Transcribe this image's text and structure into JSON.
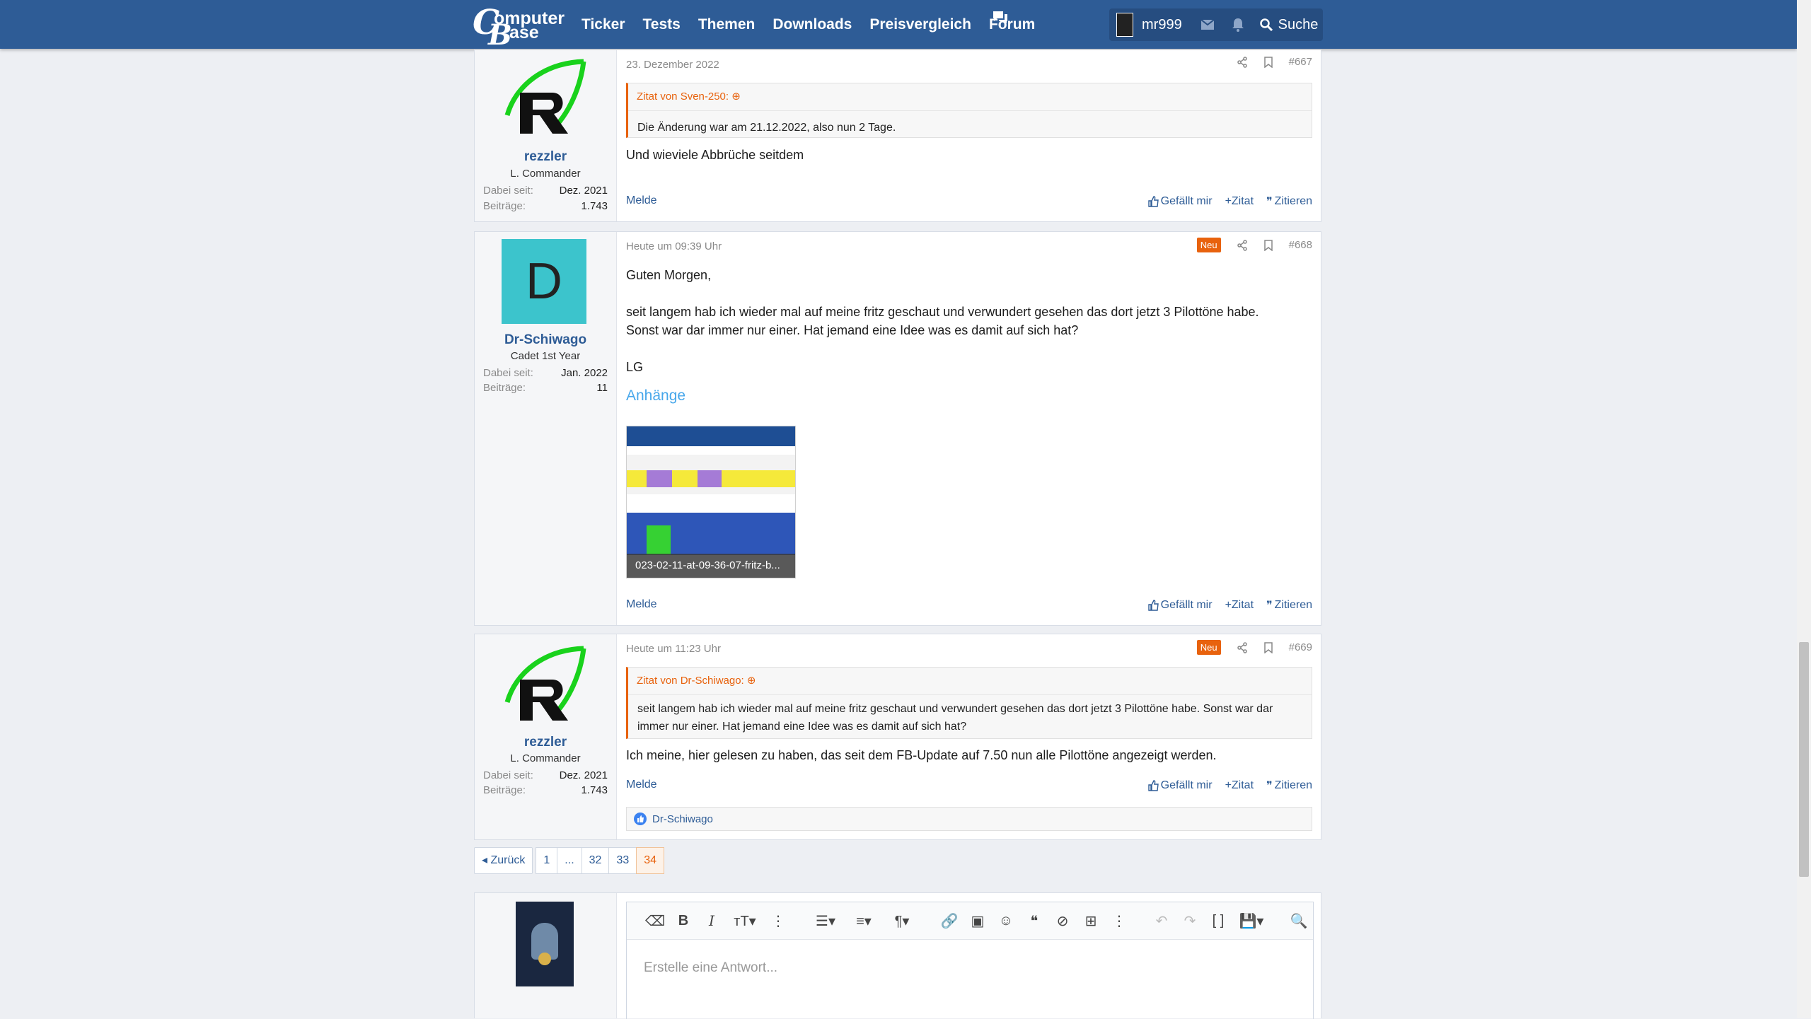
{
  "header": {
    "logo_line1": "omputer",
    "logo_line2": "ase",
    "logo_c": "C",
    "logo_b": "B",
    "nav": [
      "Ticker",
      "Tests",
      "Themen",
      "Downloads",
      "Preisvergleich",
      "Forum"
    ],
    "username": "mr999",
    "search_label": "Suche"
  },
  "posts": [
    {
      "author": "rezzler",
      "user_title": "L. Commander",
      "stats": [
        {
          "k": "Dabei seit:",
          "v": "Dez. 2021"
        },
        {
          "k": "Beiträge:",
          "v": "1.743"
        }
      ],
      "date": "23. Dezember 2022",
      "number": "#667",
      "quote_header": "Zitat von Sven-250:",
      "quote_text": "Die Änderung war am 21.12.2022, also nun 2 Tage.",
      "body": [
        "Und wieviele Abbrüche seitdem"
      ],
      "report": "Melde",
      "actions": [
        "Gefällt mir",
        "+Zitat",
        "Zitieren"
      ]
    },
    {
      "author": "Dr-Schiwago",
      "avatar_letter": "D",
      "avatar_color": "#3cc4cc",
      "user_title": "Cadet 1st Year",
      "stats": [
        {
          "k": "Dabei seit:",
          "v": "Jan. 2022"
        },
        {
          "k": "Beiträge:",
          "v": "11"
        }
      ],
      "date": "Heute um 09:39 Uhr",
      "badge": "Neu",
      "number": "#668",
      "body": [
        "Guten Morgen,",
        "seit langem hab ich wieder mal auf meine fritz geschaut und verwundert gesehen das dort jetzt 3 Pilottöne habe.",
        "Sonst war dar immer nur einer. Hat jemand eine Idee was es damit auf sich hat?",
        "LG"
      ],
      "attachments_title": "Anhänge",
      "attachment_caption": "023-02-11-at-09-36-07-fritz-b...",
      "report": "Melde",
      "actions": [
        "Gefällt mir",
        "+Zitat",
        "Zitieren"
      ]
    },
    {
      "author": "rezzler",
      "user_title": "L. Commander",
      "stats": [
        {
          "k": "Dabei seit:",
          "v": "Dez. 2021"
        },
        {
          "k": "Beiträge:",
          "v": "1.743"
        }
      ],
      "date": "Heute um 11:23 Uhr",
      "badge": "Neu",
      "number": "#669",
      "quote_header": "Zitat von Dr-Schiwago:",
      "quote_text_1": "seit langem hab ich wieder mal auf meine fritz geschaut und verwundert gesehen das dort jetzt 3 Pilottöne habe. Sonst war dar",
      "quote_text_2": "immer nur einer. Hat jemand eine Idee was es damit auf sich hat?",
      "body": [
        "Ich meine, hier gelesen zu haben, das seit dem FB-Update auf 7.50 nun alle Pilottöne angezeigt werden."
      ],
      "report": "Melde",
      "actions": [
        "Gefällt mir",
        "+Zitat",
        "Zitieren"
      ],
      "reaction_user": "Dr-Schiwago"
    }
  ],
  "pagination": {
    "prev": "Zurück",
    "pages": [
      "1",
      "...",
      "32",
      "33",
      "34"
    ],
    "current": "34"
  },
  "editor": {
    "placeholder": "Erstelle eine Antwort..."
  },
  "colors": {
    "brand": "#2e5c96",
    "accent": "#e8620d",
    "link": "#47a7eb"
  }
}
